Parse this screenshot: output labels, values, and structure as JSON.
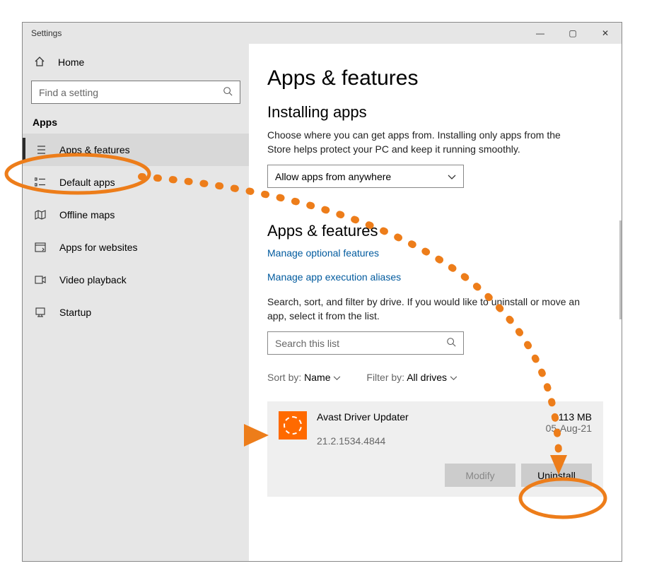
{
  "window": {
    "title": "Settings",
    "buttons": {
      "min": "—",
      "max": "▢",
      "close": "✕"
    }
  },
  "sidebar": {
    "home": "Home",
    "search_placeholder": "Find a setting",
    "group": "Apps",
    "items": [
      {
        "label": "Apps & features"
      },
      {
        "label": "Default apps"
      },
      {
        "label": "Offline maps"
      },
      {
        "label": "Apps for websites"
      },
      {
        "label": "Video playback"
      },
      {
        "label": "Startup"
      }
    ]
  },
  "main": {
    "title": "Apps & features",
    "installing": {
      "heading": "Installing apps",
      "help": "Choose where you can get apps from. Installing only apps from the Store helps protect your PC and keep it running smoothly.",
      "dropdown": "Allow apps from anywhere"
    },
    "features": {
      "heading": "Apps & features",
      "link1": "Manage optional features",
      "link2": "Manage app execution aliases",
      "help2": "Search, sort, and filter by drive. If you would like to uninstall or move an app, select it from the list.",
      "search_placeholder": "Search this list",
      "sort_label": "Sort by:",
      "sort_value": "Name",
      "filter_label": "Filter by:",
      "filter_value": "All drives"
    },
    "app": {
      "name": "Avast Driver Updater",
      "version": "21.2.1534.4844",
      "size": "113 MB",
      "date": "05-Aug-21",
      "modify": "Modify",
      "uninstall": "Uninstall"
    }
  },
  "annotation": {
    "color": "#ed7d1a"
  }
}
